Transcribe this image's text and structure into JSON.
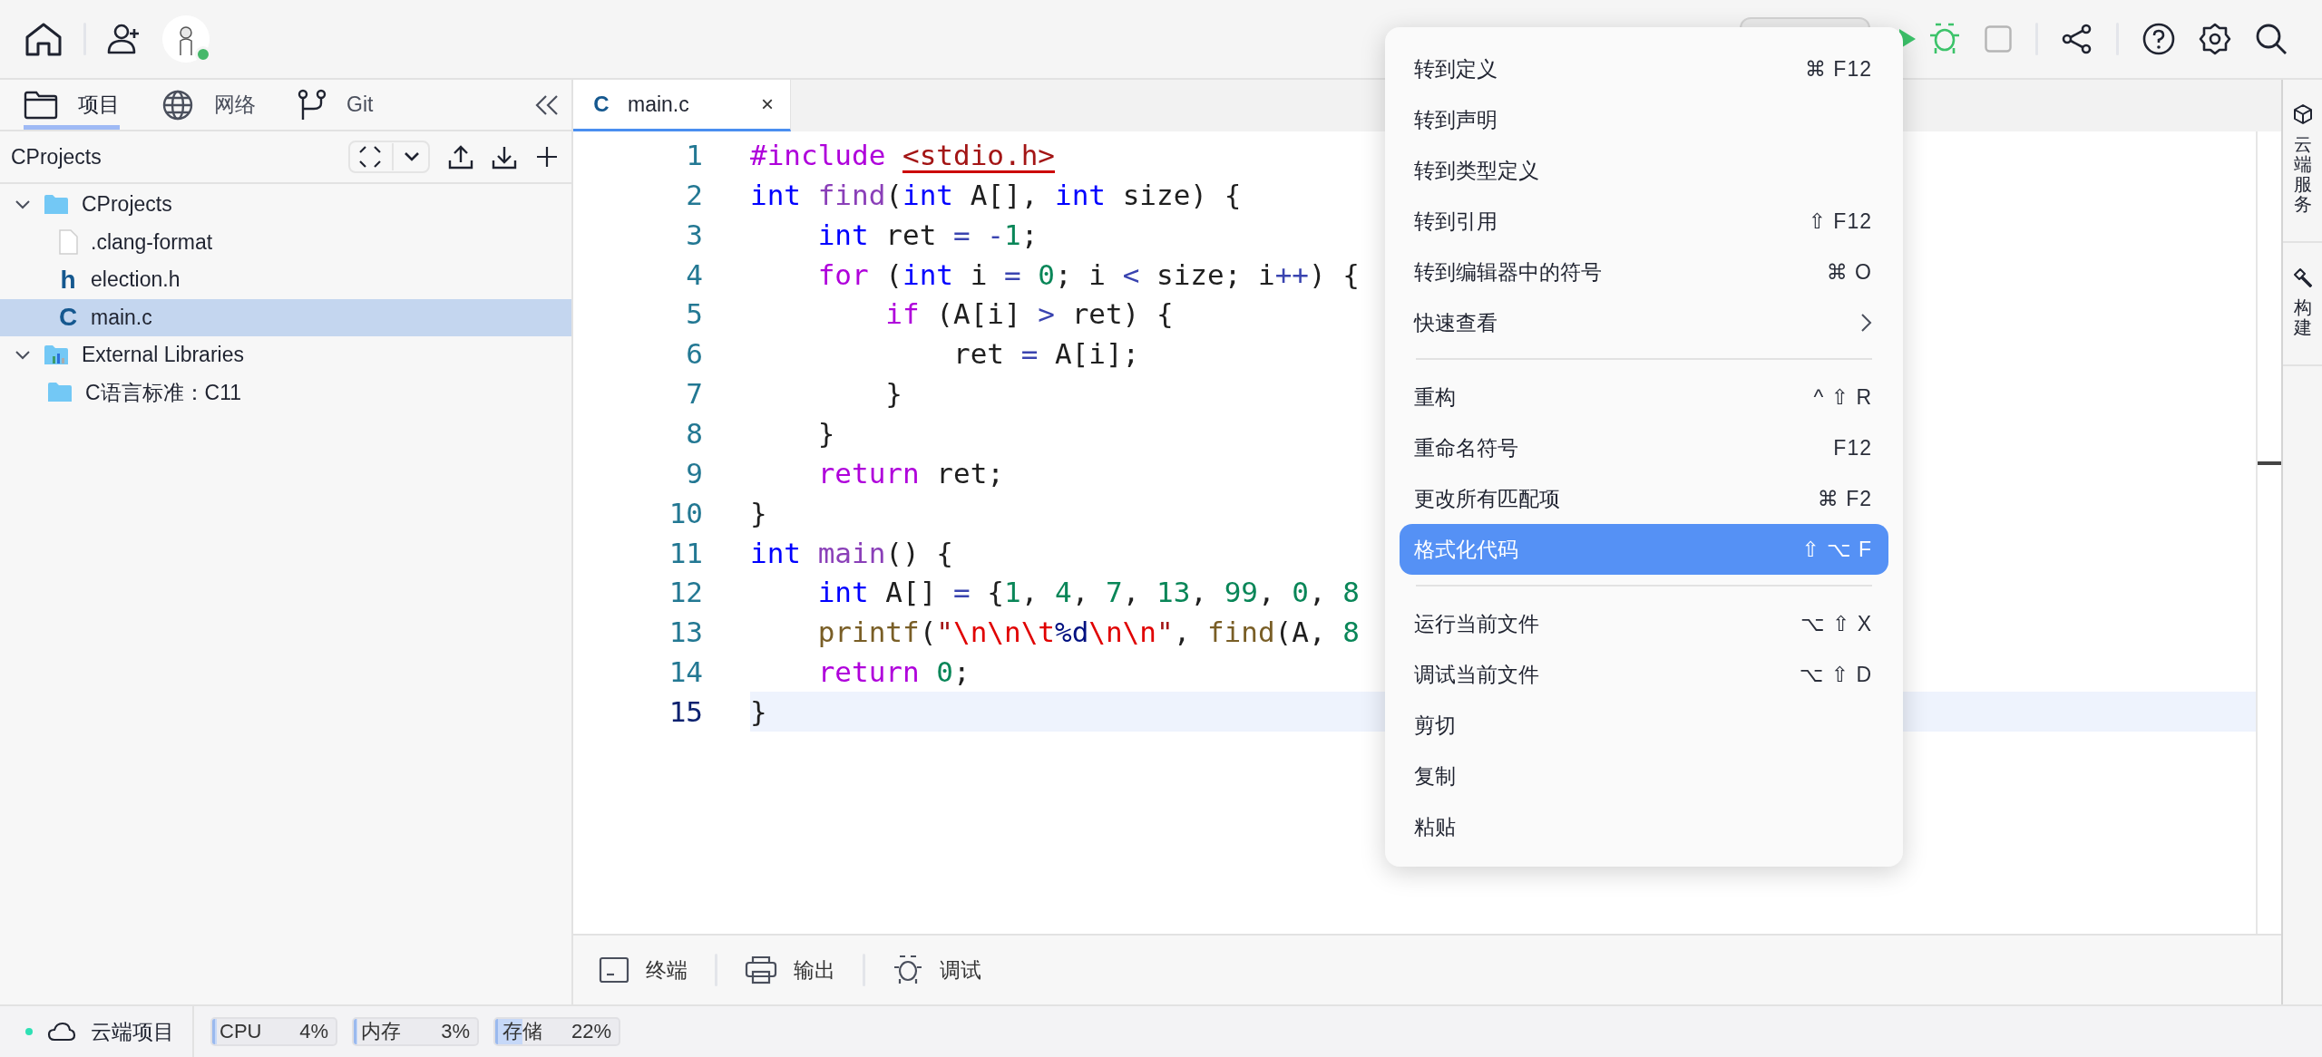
{
  "topbar": {
    "avatar": {
      "online": true
    },
    "run_buttons": [
      {
        "kind": "run"
      },
      {
        "kind": "debug"
      },
      {
        "kind": "stop"
      }
    ]
  },
  "sidebar": {
    "tabs": [
      {
        "label": "项目",
        "kind": "folder",
        "selected": true
      },
      {
        "label": "网络",
        "kind": "globe",
        "selected": false
      },
      {
        "label": "Git",
        "kind": "branch",
        "selected": false
      }
    ],
    "header": {
      "title": "CProjects"
    },
    "tree": [
      {
        "label": "CProjects",
        "kind": "folder",
        "expanded": true,
        "selected": false,
        "children": [
          {
            "label": ".clang-format",
            "kind": "file",
            "selected": false
          },
          {
            "label": "election.h",
            "kind": "glyph",
            "glyph": "h",
            "selected": false
          },
          {
            "label": "main.c",
            "kind": "glyph",
            "glyph": "C",
            "selected": true
          }
        ]
      },
      {
        "label": "External Libraries",
        "kind": "library",
        "expanded": true,
        "selected": false,
        "children": [
          {
            "label": "C语言标准：C11",
            "kind": "folder",
            "selected": false
          }
        ]
      }
    ]
  },
  "editor": {
    "tabs": [
      {
        "glyph": "C",
        "label": "main.c",
        "close": "×",
        "selected": true
      }
    ],
    "lines": [
      {
        "number": "1",
        "current": false,
        "tokens": [
          {
            "text": "#include ",
            "kind": "control"
          },
          {
            "text": "<stdio.h>",
            "kind": "path"
          }
        ]
      },
      {
        "number": "2",
        "current": false,
        "tokens": [
          {
            "text": "int",
            "kind": "type"
          },
          {
            "text": " find",
            "kind": "function"
          },
          {
            "text": "(",
            "kind": "plain"
          },
          {
            "text": "int",
            "kind": "type"
          },
          {
            "text": " A[], ",
            "kind": "plain"
          },
          {
            "text": "int",
            "kind": "type"
          },
          {
            "text": " size) {",
            "kind": "plain"
          }
        ]
      },
      {
        "number": "3",
        "current": false,
        "tokens": [
          {
            "text": "    int",
            "kind": "type"
          },
          {
            "text": " ret ",
            "kind": "plain"
          },
          {
            "text": "=",
            "kind": "operator"
          },
          {
            "text": " -",
            "kind": "operator"
          },
          {
            "text": "1",
            "kind": "number"
          },
          {
            "text": ";",
            "kind": "plain"
          }
        ]
      },
      {
        "number": "4",
        "current": false,
        "tokens": [
          {
            "text": "    for",
            "kind": "control"
          },
          {
            "text": " (",
            "kind": "plain"
          },
          {
            "text": "int",
            "kind": "type"
          },
          {
            "text": " i ",
            "kind": "plain"
          },
          {
            "text": "=",
            "kind": "operator"
          },
          {
            "text": " 0",
            "kind": "number"
          },
          {
            "text": "; i ",
            "kind": "plain"
          },
          {
            "text": "<",
            "kind": "operator"
          },
          {
            "text": " size; i",
            "kind": "plain"
          },
          {
            "text": "++",
            "kind": "operator"
          },
          {
            "text": ") {",
            "kind": "plain"
          }
        ]
      },
      {
        "number": "5",
        "current": false,
        "tokens": [
          {
            "text": "        if",
            "kind": "control"
          },
          {
            "text": " (A[i] ",
            "kind": "plain"
          },
          {
            "text": ">",
            "kind": "operator"
          },
          {
            "text": " ret) {",
            "kind": "plain"
          }
        ]
      },
      {
        "number": "6",
        "current": false,
        "tokens": [
          {
            "text": "            ret ",
            "kind": "plain"
          },
          {
            "text": "=",
            "kind": "operator"
          },
          {
            "text": " A[i];",
            "kind": "plain"
          }
        ]
      },
      {
        "number": "7",
        "current": false,
        "tokens": [
          {
            "text": "        }",
            "kind": "plain"
          }
        ]
      },
      {
        "number": "8",
        "current": false,
        "tokens": [
          {
            "text": "    }",
            "kind": "plain"
          }
        ]
      },
      {
        "number": "9",
        "current": false,
        "tokens": [
          {
            "text": "    return",
            "kind": "control"
          },
          {
            "text": " ret;",
            "kind": "plain"
          }
        ]
      },
      {
        "number": "10",
        "current": false,
        "tokens": [
          {
            "text": "}",
            "kind": "plain"
          }
        ]
      },
      {
        "number": "11",
        "current": false,
        "tokens": [
          {
            "text": "int",
            "kind": "type"
          },
          {
            "text": " main",
            "kind": "function"
          },
          {
            "text": "() {",
            "kind": "plain"
          }
        ]
      },
      {
        "number": "12",
        "current": false,
        "tokens": [
          {
            "text": "    int",
            "kind": "type"
          },
          {
            "text": " A[] ",
            "kind": "plain"
          },
          {
            "text": "=",
            "kind": "operator"
          },
          {
            "text": " {",
            "kind": "plain"
          },
          {
            "text": "1",
            "kind": "number"
          },
          {
            "text": ", ",
            "kind": "plain"
          },
          {
            "text": "4",
            "kind": "number"
          },
          {
            "text": ", ",
            "kind": "plain"
          },
          {
            "text": "7",
            "kind": "number"
          },
          {
            "text": ", ",
            "kind": "plain"
          },
          {
            "text": "13",
            "kind": "number"
          },
          {
            "text": ", ",
            "kind": "plain"
          },
          {
            "text": "99",
            "kind": "number"
          },
          {
            "text": ", ",
            "kind": "plain"
          },
          {
            "text": "0",
            "kind": "number"
          },
          {
            "text": ", ",
            "kind": "plain"
          },
          {
            "text": "8",
            "kind": "number"
          }
        ]
      },
      {
        "number": "13",
        "current": false,
        "tokens": [
          {
            "text": "    printf",
            "kind": "call"
          },
          {
            "text": "(",
            "kind": "plain"
          },
          {
            "text": "\"",
            "kind": "string"
          },
          {
            "text": "\\n\\n\\t",
            "kind": "escape"
          },
          {
            "text": "%d",
            "kind": "format"
          },
          {
            "text": "\\n\\n",
            "kind": "escape"
          },
          {
            "text": "\"",
            "kind": "string"
          },
          {
            "text": ", ",
            "kind": "plain"
          },
          {
            "text": "find",
            "kind": "call"
          },
          {
            "text": "(A, ",
            "kind": "plain"
          },
          {
            "text": "8",
            "kind": "number"
          }
        ]
      },
      {
        "number": "14",
        "current": false,
        "tokens": [
          {
            "text": "    return",
            "kind": "control"
          },
          {
            "text": " 0",
            "kind": "number"
          },
          {
            "text": ";",
            "kind": "plain"
          }
        ]
      },
      {
        "number": "15",
        "current": true,
        "tokens": [
          {
            "text": "}",
            "kind": "plain"
          }
        ]
      }
    ]
  },
  "panel_tabs": [
    {
      "label": "终端",
      "kind": "terminal"
    },
    {
      "label": "输出",
      "kind": "printer"
    },
    {
      "label": "调试",
      "kind": "bug"
    }
  ],
  "right_strip": [
    {
      "label": "云端服务",
      "kind": "cube"
    },
    {
      "label": "构建",
      "kind": "hammer"
    }
  ],
  "status_bar": {
    "connected": true,
    "project": "云端项目",
    "meters": [
      {
        "label": "CPU",
        "reading": "4%",
        "level": 0.04
      },
      {
        "label": "内存",
        "reading": "3%",
        "level": 0.03
      },
      {
        "label": "存储",
        "reading": "22%",
        "level": 0.22
      }
    ]
  },
  "context_menu": {
    "groups": [
      [
        {
          "label": "转到定义",
          "shortcut": "⌘ F12",
          "submenu": false,
          "selected": false
        },
        {
          "label": "转到声明",
          "submenu": false,
          "selected": false
        },
        {
          "label": "转到类型定义",
          "submenu": false,
          "selected": false
        },
        {
          "label": "转到引用",
          "shortcut": "⇧ F12",
          "submenu": false,
          "selected": false
        },
        {
          "label": "转到编辑器中的符号",
          "shortcut": "⌘ O",
          "submenu": false,
          "selected": false
        },
        {
          "label": "快速查看",
          "submenu": true,
          "selected": false
        }
      ],
      [
        {
          "label": "重构",
          "shortcut": "^ ⇧ R",
          "submenu": false,
          "selected": false
        },
        {
          "label": "重命名符号",
          "shortcut": "F12",
          "submenu": false,
          "selected": false
        },
        {
          "label": "更改所有匹配项",
          "shortcut": "⌘ F2",
          "submenu": false,
          "selected": false
        },
        {
          "label": "格式化代码",
          "shortcut": "⇧ ⌥ F",
          "submenu": false,
          "selected": true
        }
      ],
      [
        {
          "label": "运行当前文件",
          "shortcut": "⌥ ⇧ X",
          "submenu": false,
          "selected": false
        },
        {
          "label": "调试当前文件",
          "shortcut": "⌥ ⇧ D",
          "submenu": false,
          "selected": false
        },
        {
          "label": "剪切",
          "submenu": false,
          "selected": false
        },
        {
          "label": "复制",
          "submenu": false,
          "selected": false
        },
        {
          "label": "粘贴",
          "submenu": false,
          "selected": false
        }
      ]
    ]
  }
}
